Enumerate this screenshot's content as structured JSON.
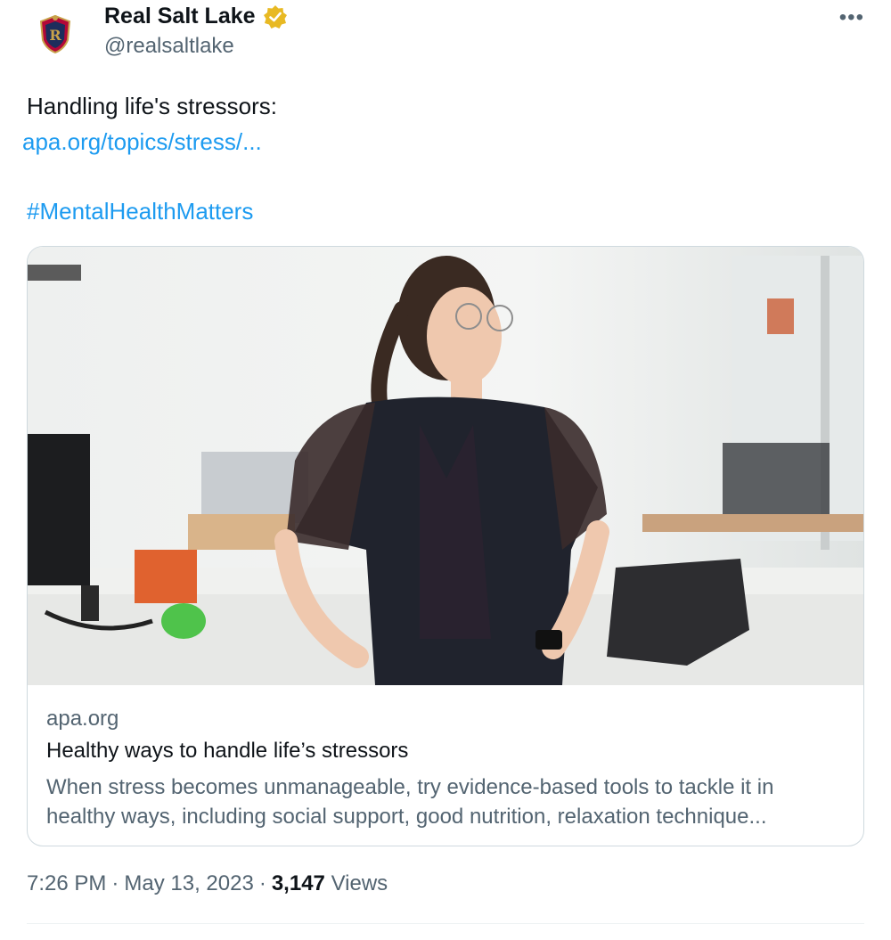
{
  "account": {
    "name": "Real Salt Lake",
    "handle": "@realsaltlake",
    "verified_badge": "gold-verified-badge-icon"
  },
  "more_label": "•••",
  "tweet": {
    "line1": "Handling life's stressors:",
    "link": "apa.org/topics/stress/...",
    "hashtag": "#MentalHealthMatters"
  },
  "card": {
    "domain": "apa.org",
    "title": "Healthy ways to handle life’s stressors",
    "description_line1": "When stress becomes unmanageable, try evidence-based tools to tackle it in",
    "description_line2": "healthy ways, including social support, good nutrition, relaxation technique..."
  },
  "meta": {
    "time": "7:26 PM",
    "sep1": "·",
    "date": "May 13, 2023",
    "sep2": "·",
    "views_count": "3,147",
    "views_label": "Views"
  },
  "colors": {
    "link": "#1d9bf0",
    "text": "#0f1419",
    "muted": "#536471",
    "badge": "#e8b923"
  }
}
